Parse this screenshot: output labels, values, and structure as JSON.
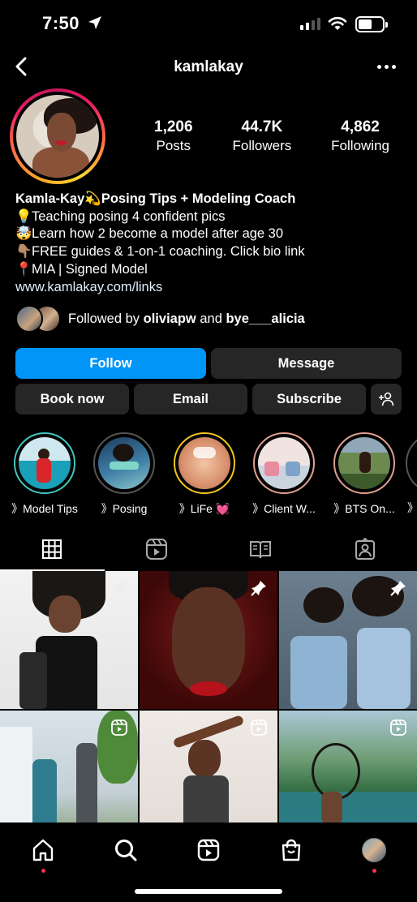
{
  "status": {
    "time": "7:50"
  },
  "header": {
    "username": "kamlakay"
  },
  "stats": [
    {
      "num": "1,206",
      "label": "Posts"
    },
    {
      "num": "44.7K",
      "label": "Followers"
    },
    {
      "num": "4,862",
      "label": "Following"
    }
  ],
  "bio": {
    "name": "Kamla-Kay",
    "name_emoji": "💫",
    "name_rest": "Posing Tips + Modeling Coach",
    "lines": [
      {
        "emoji": "💡",
        "text": "Teaching posing 4 confident pics"
      },
      {
        "emoji": "🤯",
        "text": "Learn how 2 become a model after age 30"
      },
      {
        "emoji": "👇🏽",
        "text": "FREE guides & 1-on-1 coaching. Click bio link"
      },
      {
        "emoji": "📍",
        "text": "MIA | Signed Model"
      }
    ],
    "link": "www.kamlakay.com/links"
  },
  "followed_by": {
    "prefix": "Followed by",
    "user1": "oliviapw",
    "joiner": "and",
    "user2": "bye___alicia"
  },
  "buttons": {
    "follow": "Follow",
    "message": "Message",
    "book": "Book now",
    "email": "Email",
    "subscribe": "Subscribe"
  },
  "highlights": [
    {
      "label": "》Model Tips",
      "ring": "#3ec7c0"
    },
    {
      "label": "》Posing",
      "ring": "#555555"
    },
    {
      "label": "》LiFe 💓",
      "ring": "#f5c518"
    },
    {
      "label": "》Client W...",
      "ring": "#e0a090"
    },
    {
      "label": "》BTS On...",
      "ring": "#e0a090"
    }
  ],
  "colors": {
    "accent": "#0095f6",
    "secondary_button": "#262626",
    "notification": "#ff3040"
  }
}
